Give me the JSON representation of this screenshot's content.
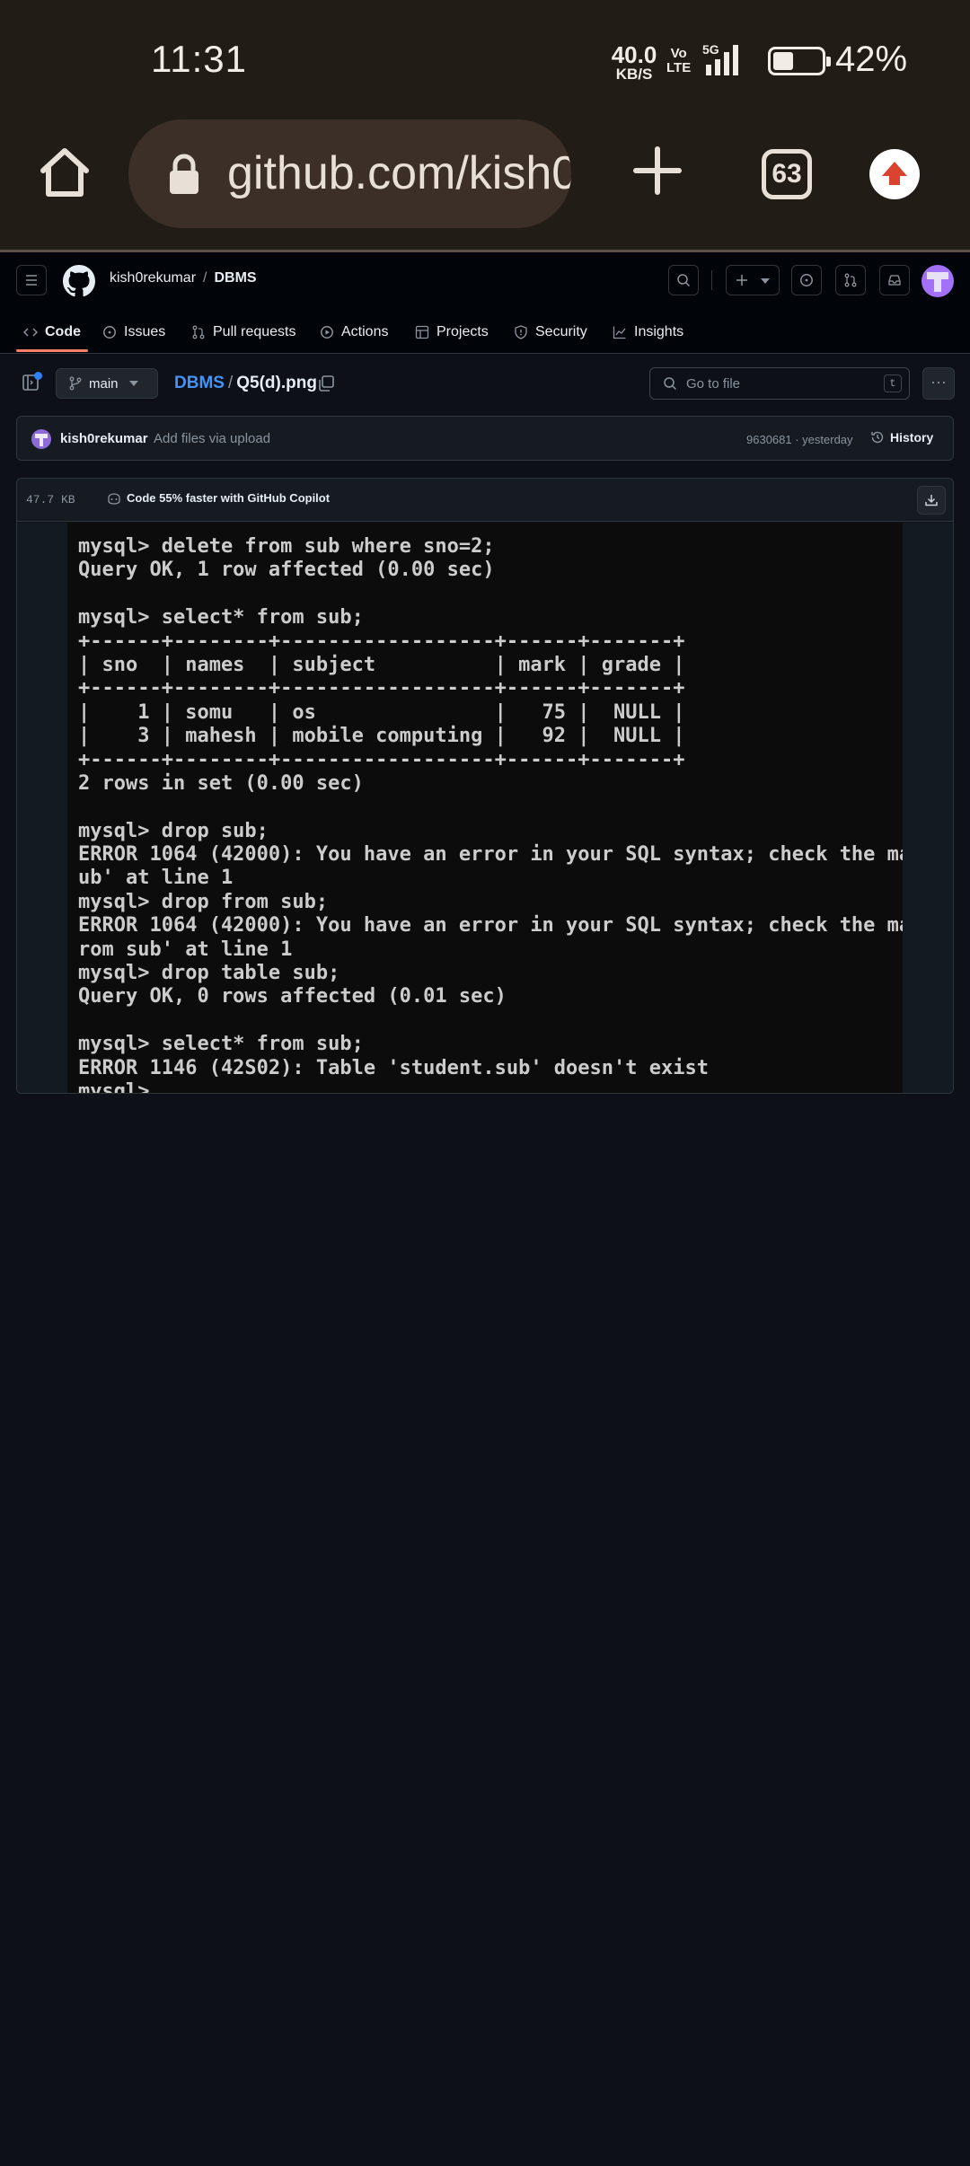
{
  "status_bar": {
    "time": "11:31",
    "net_speed_value": "40.0",
    "net_speed_unit": "KB/S",
    "volte_top": "Vo",
    "volte_bottom": "LTE",
    "network": "5G",
    "battery_percent": "42%",
    "battery_level": 0.42
  },
  "browser": {
    "url": "github.com/kish0rekumar/DBMS/blob/main/Q5(d).png",
    "tab_count": "63",
    "icons": [
      "home-icon",
      "lock-icon",
      "plus-icon",
      "tabs-icon",
      "update-icon"
    ]
  },
  "github": {
    "owner": "kish0rekumar",
    "separator": "/",
    "repo": "DBMS",
    "nav_tabs": [
      {
        "label": "Code",
        "icon": "code-icon"
      },
      {
        "label": "Issues",
        "icon": "issue-icon"
      },
      {
        "label": "Pull requests",
        "icon": "pull-request-icon"
      },
      {
        "label": "Actions",
        "icon": "play-icon"
      },
      {
        "label": "Projects",
        "icon": "table-icon"
      },
      {
        "label": "Security",
        "icon": "shield-icon"
      },
      {
        "label": "Insights",
        "icon": "graph-icon"
      }
    ],
    "active_tab": "Code",
    "accent": "#f78166"
  },
  "file_nav": {
    "branch": "main",
    "dir": "DBMS",
    "slash": "/",
    "file": "Q5(d).png",
    "go_to_file_placeholder": "Go to file",
    "shortcut": "t"
  },
  "commit": {
    "author": "kish0rekumar",
    "message": "Add files via upload",
    "hash_time": "9630681 · yesterday",
    "history_label": "History"
  },
  "file": {
    "size": "47.7 KB",
    "copilot_label": "Code 55% faster with GitHub Copilot",
    "terminal_lines": [
      "mysql> delete from sub where sno=2;",
      "Query OK, 1 row affected (0.00 sec)",
      "",
      "mysql> select* from sub;",
      "+------+--------+------------------+------+-------+",
      "| sno  | names  | subject          | mark | grade |",
      "+------+--------+------------------+------+-------+",
      "|    1 | somu   | os               |   75 |  NULL |",
      "|    3 | mahesh | mobile computing |   92 |  NULL |",
      "+------+--------+------------------+------+-------+",
      "2 rows in set (0.00 sec)",
      "",
      "mysql> drop sub;",
      "ERROR 1064 (42000): You have an error in your SQL syntax; check the ma",
      "ub' at line 1",
      "mysql> drop from sub;",
      "ERROR 1064 (42000): You have an error in your SQL syntax; check the ma",
      "rom sub' at line 1",
      "mysql> drop table sub;",
      "Query OK, 0 rows affected (0.01 sec)",
      "",
      "mysql> select* from sub;",
      "ERROR 1146 (42S02): Table 'student.sub' doesn't exist",
      "mysql>"
    ]
  }
}
